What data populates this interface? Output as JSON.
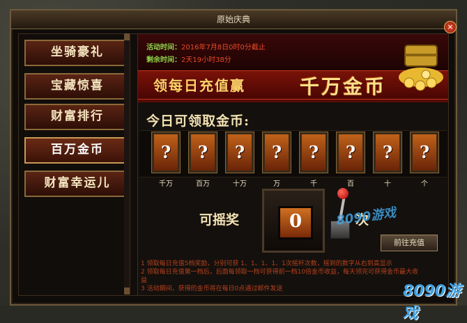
{
  "window": {
    "title": "原始庆典",
    "close_symbol": "×"
  },
  "sidebar": {
    "items": [
      {
        "label": "坐骑豪礼",
        "active": false
      },
      {
        "label": "宝藏惊喜",
        "active": false
      },
      {
        "label": "财富排行",
        "active": false
      },
      {
        "label": "百万金币",
        "active": true
      },
      {
        "label": "财富幸运儿",
        "active": false
      }
    ]
  },
  "banner": {
    "time_label": "活动时间：",
    "time_value": "2016年7月8日0时0分截止",
    "remain_label": "剩余时间：",
    "remain_value": "2天19小时38分",
    "slogan_small": "领每日充值赢",
    "slogan_big": "千万金币"
  },
  "main": {
    "section_title": "今日可领取金币:",
    "slots": [
      {
        "symbol": "?",
        "label": "千万"
      },
      {
        "symbol": "?",
        "label": "百万"
      },
      {
        "symbol": "?",
        "label": "十万"
      },
      {
        "symbol": "?",
        "label": "万"
      },
      {
        "symbol": "?",
        "label": "千"
      },
      {
        "symbol": "?",
        "label": "百"
      },
      {
        "symbol": "?",
        "label": "十"
      },
      {
        "symbol": "?",
        "label": "个"
      }
    ],
    "lottery_label": "可摇奖",
    "lottery_count": "0",
    "count_unit": "次",
    "recharge_button": "前往充值"
  },
  "rules": [
    "1  领取每日充值5档奖励，分别可获 1、1、1、1、1次摇杆次数，摇到的数字从右到高显示",
    "2  领取每日充值第一档后，后面每领取一档可获得前一档10倍金币收益，每天领完可获得金币最大收",
    "    益",
    "3  活动期间，获得的金币将在每日0点通过邮件发送"
  ],
  "watermarks": {
    "mid": "8090游戏",
    "corner": "8090游戏"
  }
}
